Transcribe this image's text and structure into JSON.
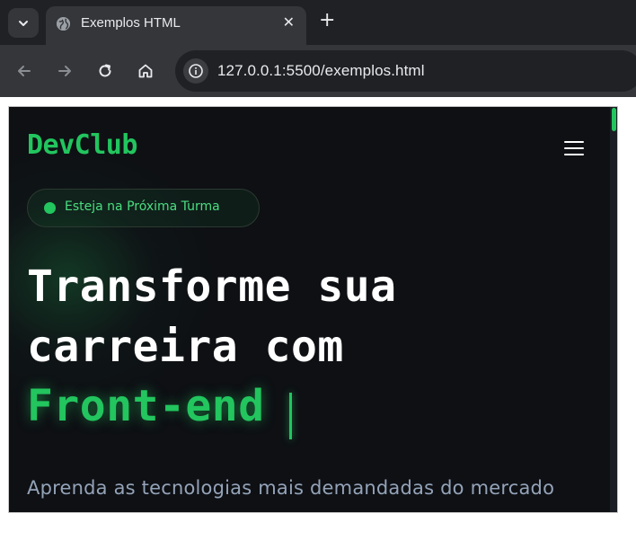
{
  "browser": {
    "tab_title": "Exemplos HTML",
    "url_host": "127.0.0.1",
    "url_rest": ":5500/exemplos.html",
    "tab_close_glyph": "✕",
    "new_tab_glyph": "+",
    "icons": [
      "chevron-down-icon",
      "globe-icon",
      "close-icon",
      "plus-icon",
      "back-arrow-icon",
      "forward-arrow-icon",
      "reload-icon",
      "home-icon",
      "info-icon"
    ]
  },
  "page": {
    "logo": "DevClub",
    "badge": "Esteja na Próxima Turma",
    "hero_line_1": "Transforme sua",
    "hero_line_2": "carreira com",
    "hero_highlight": "Front-end",
    "subtitle": "Aprenda as tecnologias mais demandadas do mercado",
    "colors": {
      "accent": "#22c55e",
      "background": "#0e1014",
      "subtitle": "#94a3b8"
    }
  }
}
